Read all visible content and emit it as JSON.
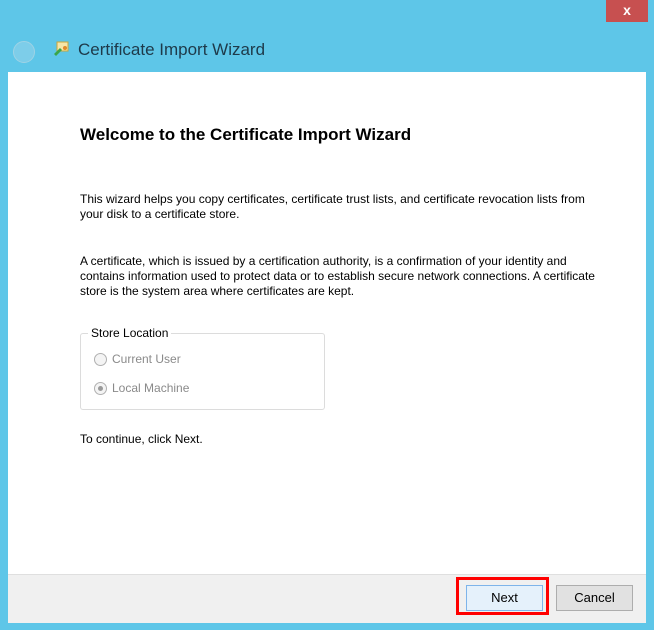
{
  "window": {
    "title": "Certificate Import Wizard",
    "close_label": "x"
  },
  "heading": "Welcome to the Certificate Import Wizard",
  "paragraph1": "This wizard helps you copy certificates, certificate trust lists, and certificate revocation lists from your disk to a certificate store.",
  "paragraph2": "A certificate, which is issued by a certification authority, is a confirmation of your identity and contains information used to protect data or to establish secure network connections. A certificate store is the system area where certificates are kept.",
  "store_location": {
    "label": "Store Location",
    "options": [
      {
        "label": "Current User",
        "selected": false
      },
      {
        "label": "Local Machine",
        "selected": true
      }
    ]
  },
  "continue_text": "To continue, click Next.",
  "buttons": {
    "next": "Next",
    "cancel": "Cancel"
  }
}
